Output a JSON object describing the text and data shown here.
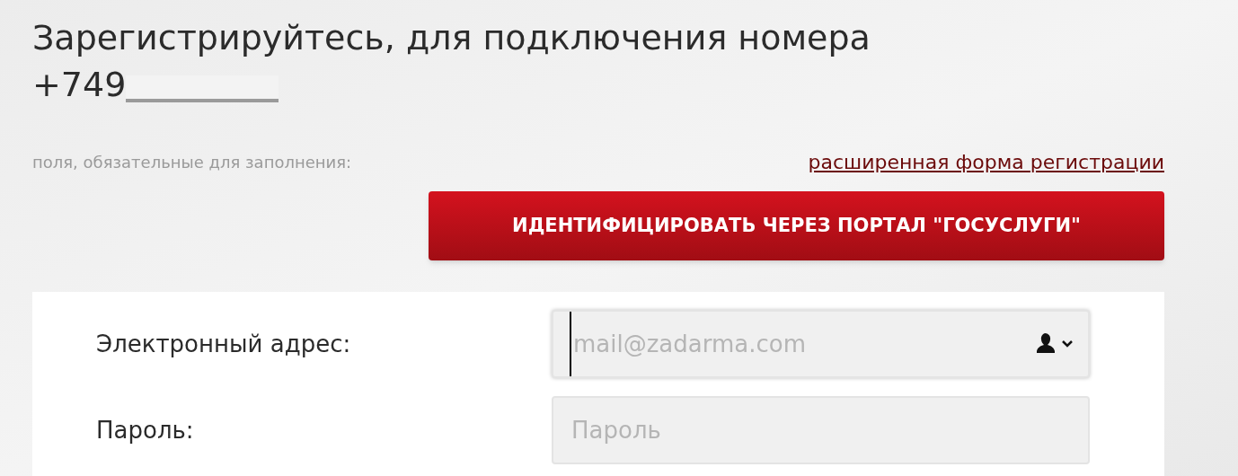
{
  "heading": {
    "title": "Зарегистрируйтесь, для подключения номера",
    "phone": "+749"
  },
  "required_note": "поля, обязательные для заполнения:",
  "extended_link": "расширенная форма регистрации",
  "gosuslugi_button": "ИДЕНТИФИЦИРОВАТЬ ЧЕРЕЗ ПОРТАЛ \"ГОСУСЛУГИ\"",
  "fields": [
    {
      "label": "Электронный адрес:",
      "placeholder": "mail@zadarma.com",
      "focused": true,
      "kind": "email"
    },
    {
      "label": "Пароль:",
      "placeholder": "Пароль",
      "focused": false,
      "kind": "password"
    }
  ]
}
